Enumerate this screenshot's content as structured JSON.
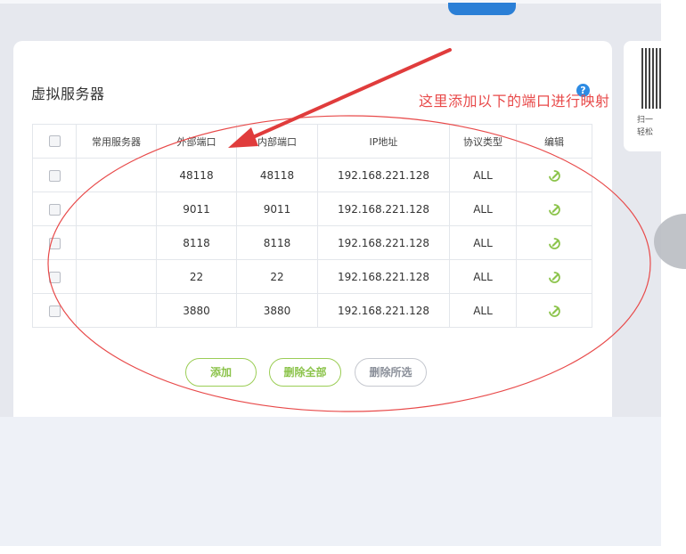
{
  "page": {
    "title": "虚拟服务器",
    "help": "?"
  },
  "annotation": {
    "text": "这里添加以下的端口进行映射",
    "color": "#e84a4a"
  },
  "table": {
    "headers": [
      "常用服务器",
      "外部端口",
      "内部端口",
      "IP地址",
      "协议类型",
      "编辑"
    ],
    "rows": [
      {
        "server": "",
        "external": "48118",
        "internal": "48118",
        "ip": "192.168.221.128",
        "protocol": "ALL"
      },
      {
        "server": "",
        "external": "9011",
        "internal": "9011",
        "ip": "192.168.221.128",
        "protocol": "ALL"
      },
      {
        "server": "",
        "external": "8118",
        "internal": "8118",
        "ip": "192.168.221.128",
        "protocol": "ALL"
      },
      {
        "server": "",
        "external": "22",
        "internal": "22",
        "ip": "192.168.221.128",
        "protocol": "ALL"
      },
      {
        "server": "",
        "external": "3880",
        "internal": "3880",
        "ip": "192.168.221.128",
        "protocol": "ALL"
      }
    ]
  },
  "buttons": {
    "add": "添加",
    "delete_all": "删除全部",
    "delete_selected": "删除所选"
  },
  "side": {
    "qr_text_1": "扫一",
    "qr_text_2": "轻松"
  },
  "icons": {
    "edit": "edit-pencil-icon",
    "help": "question-circle-icon",
    "qr": "qr-code-icon"
  },
  "colors": {
    "accent_green": "#8bc34a",
    "help_blue": "#2d8be3",
    "annotation_red": "#e84a4a"
  }
}
